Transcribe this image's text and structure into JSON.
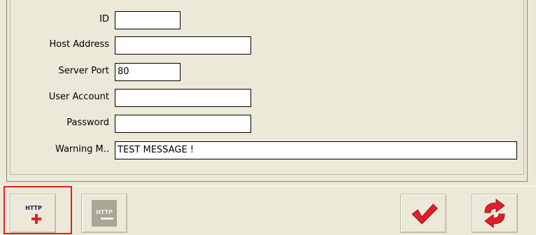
{
  "form": {
    "fields": [
      {
        "label": "ID",
        "value": ""
      },
      {
        "label": "Host Address",
        "value": ""
      },
      {
        "label": "Server Port",
        "value": "80"
      },
      {
        "label": "User Account",
        "value": ""
      },
      {
        "label": "Password",
        "value": ""
      },
      {
        "label": "Warning M..",
        "value": "TEST MESSAGE !"
      }
    ]
  },
  "toolbar": {
    "add_http_icon_text": "HTTP",
    "remove_http_icon_text": "HTTP",
    "confirm_icon": "check-icon",
    "refresh_icon": "refresh-icon"
  },
  "colors": {
    "background": "#ece9d8",
    "accent_red": "#e0202a",
    "highlight_border": "#e02020"
  }
}
